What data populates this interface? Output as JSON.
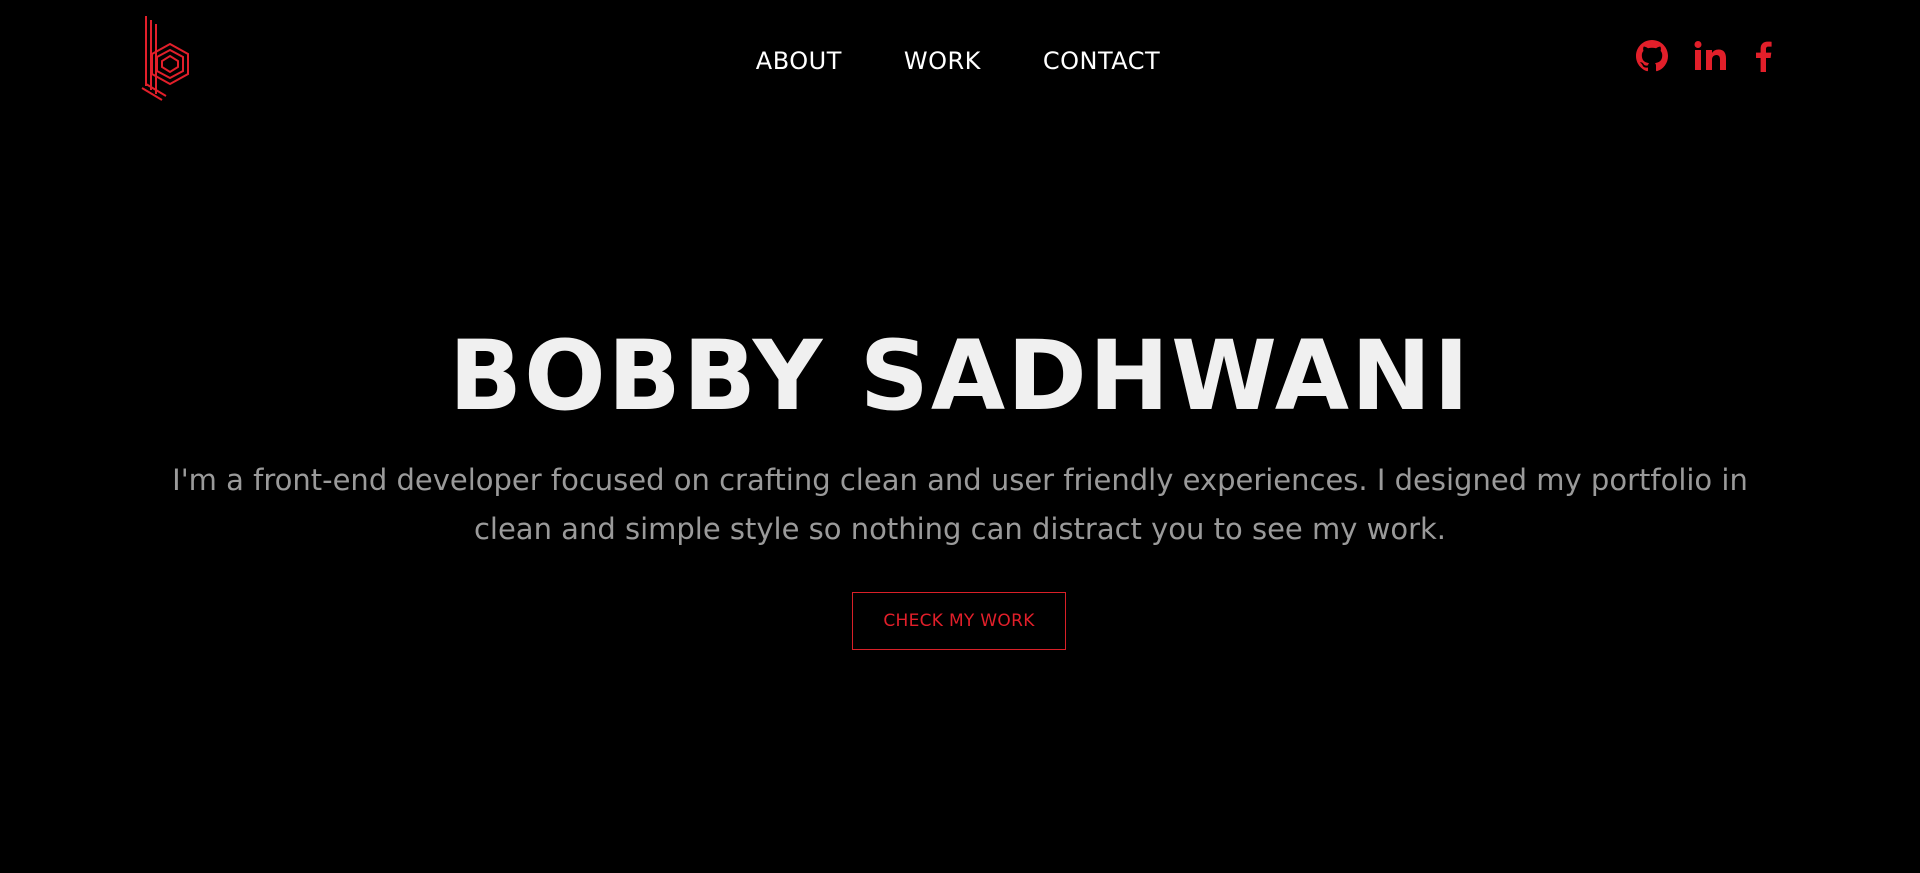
{
  "header": {
    "logo_icon": "hexagon-b-logo-icon",
    "nav": [
      {
        "label": "ABOUT"
      },
      {
        "label": "WORK"
      },
      {
        "label": "CONTACT"
      }
    ],
    "social": [
      {
        "icon": "github-icon"
      },
      {
        "icon": "linkedin-icon"
      },
      {
        "icon": "facebook-icon"
      }
    ]
  },
  "hero": {
    "title": "BOBBY SADHWANI",
    "description": "I'm a front-end developer focused on crafting clean and user friendly experiences. I designed my portfolio in clean and simple style so nothing can distract you to see my work.",
    "cta_label": "CHECK MY WORK"
  },
  "colors": {
    "background": "#000000",
    "accent": "#e21f2a",
    "title": "#f0f0f0",
    "body_text": "#9a9a9a",
    "nav_text": "#ffffff"
  }
}
